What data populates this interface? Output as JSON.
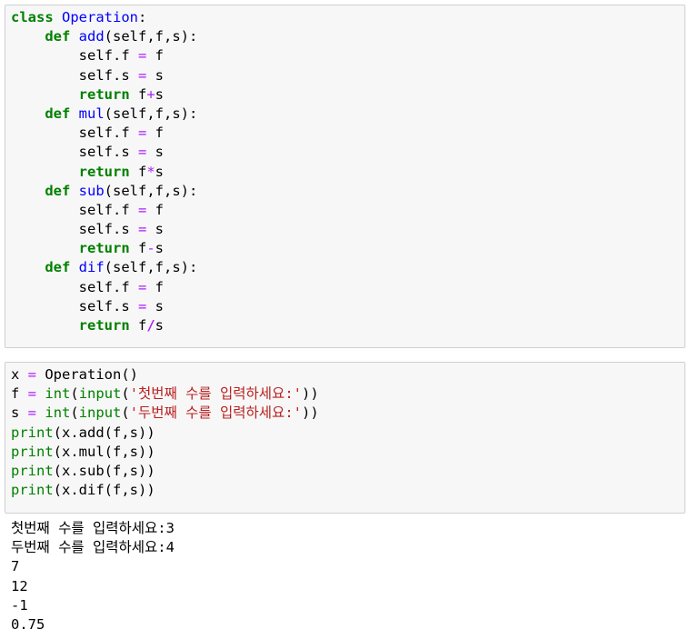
{
  "cell1": {
    "lines": [
      [
        {
          "t": "class",
          "c": "kw"
        },
        {
          "t": " "
        },
        {
          "t": "Operation",
          "c": "nc"
        },
        {
          "t": ":"
        }
      ],
      [
        {
          "t": "    "
        },
        {
          "t": "def",
          "c": "kw"
        },
        {
          "t": " "
        },
        {
          "t": "add",
          "c": "nf"
        },
        {
          "t": "(self,f,s):"
        }
      ],
      [
        {
          "t": "        self.f "
        },
        {
          "t": "=",
          "c": "op-n"
        },
        {
          "t": " f"
        }
      ],
      [
        {
          "t": "        self.s "
        },
        {
          "t": "=",
          "c": "op-n"
        },
        {
          "t": " s"
        }
      ],
      [
        {
          "t": "        "
        },
        {
          "t": "return",
          "c": "kw"
        },
        {
          "t": " f"
        },
        {
          "t": "+",
          "c": "op-n"
        },
        {
          "t": "s"
        }
      ],
      [
        {
          "t": "    "
        },
        {
          "t": "def",
          "c": "kw"
        },
        {
          "t": " "
        },
        {
          "t": "mul",
          "c": "nf"
        },
        {
          "t": "(self,f,s):"
        }
      ],
      [
        {
          "t": "        self.f "
        },
        {
          "t": "=",
          "c": "op-n"
        },
        {
          "t": " f"
        }
      ],
      [
        {
          "t": "        self.s "
        },
        {
          "t": "=",
          "c": "op-n"
        },
        {
          "t": " s"
        }
      ],
      [
        {
          "t": "        "
        },
        {
          "t": "return",
          "c": "kw"
        },
        {
          "t": " f"
        },
        {
          "t": "*",
          "c": "op-n"
        },
        {
          "t": "s"
        }
      ],
      [
        {
          "t": "    "
        },
        {
          "t": "def",
          "c": "kw"
        },
        {
          "t": " "
        },
        {
          "t": "sub",
          "c": "nf"
        },
        {
          "t": "(self,f,s):"
        }
      ],
      [
        {
          "t": "        self.f "
        },
        {
          "t": "=",
          "c": "op-n"
        },
        {
          "t": " f"
        }
      ],
      [
        {
          "t": "        self.s "
        },
        {
          "t": "=",
          "c": "op-n"
        },
        {
          "t": " s"
        }
      ],
      [
        {
          "t": "        "
        },
        {
          "t": "return",
          "c": "kw"
        },
        {
          "t": " f"
        },
        {
          "t": "-",
          "c": "op-n"
        },
        {
          "t": "s"
        }
      ],
      [
        {
          "t": "    "
        },
        {
          "t": "def",
          "c": "kw"
        },
        {
          "t": " "
        },
        {
          "t": "dif",
          "c": "nf"
        },
        {
          "t": "(self,f,s):"
        }
      ],
      [
        {
          "t": "        self.f "
        },
        {
          "t": "=",
          "c": "op-n"
        },
        {
          "t": " f"
        }
      ],
      [
        {
          "t": "        self.s "
        },
        {
          "t": "=",
          "c": "op-n"
        },
        {
          "t": " s"
        }
      ],
      [
        {
          "t": "        "
        },
        {
          "t": "return",
          "c": "kw"
        },
        {
          "t": " f"
        },
        {
          "t": "/",
          "c": "op"
        },
        {
          "t": "s"
        }
      ]
    ]
  },
  "cell2": {
    "lines": [
      [
        {
          "t": "x "
        },
        {
          "t": "=",
          "c": "op-n"
        },
        {
          "t": " Operation()"
        }
      ],
      [
        {
          "t": "f "
        },
        {
          "t": "=",
          "c": "op-n"
        },
        {
          "t": " "
        },
        {
          "t": "int",
          "c": "bi"
        },
        {
          "t": "("
        },
        {
          "t": "input",
          "c": "bi"
        },
        {
          "t": "("
        },
        {
          "t": "'첫번째 수를 입력하세요:'",
          "c": "st"
        },
        {
          "t": "))"
        }
      ],
      [
        {
          "t": "s "
        },
        {
          "t": "=",
          "c": "op-n"
        },
        {
          "t": " "
        },
        {
          "t": "int",
          "c": "bi"
        },
        {
          "t": "("
        },
        {
          "t": "input",
          "c": "bi"
        },
        {
          "t": "("
        },
        {
          "t": "'두번째 수를 입력하세요:'",
          "c": "st"
        },
        {
          "t": "))"
        }
      ],
      [
        {
          "t": "print",
          "c": "bi"
        },
        {
          "t": "(x.add(f,s))"
        }
      ],
      [
        {
          "t": "print",
          "c": "bi"
        },
        {
          "t": "(x.mul(f,s))"
        }
      ],
      [
        {
          "t": "print",
          "c": "bi"
        },
        {
          "t": "(x.sub(f,s))"
        }
      ],
      [
        {
          "t": "print",
          "c": "bi"
        },
        {
          "t": "(x.dif(f,s))"
        }
      ]
    ]
  },
  "output": {
    "lines": [
      "첫번째 수를 입력하세요:3",
      "두번째 수를 입력하세요:4",
      "7",
      "12",
      "-1",
      "0.75"
    ]
  }
}
